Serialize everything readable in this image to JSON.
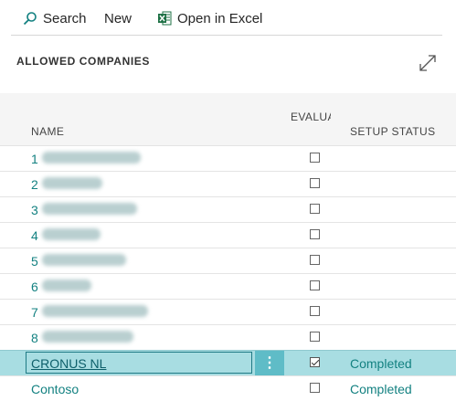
{
  "toolbar": {
    "search_label": "Search",
    "new_label": "New",
    "excel_label": "Open in Excel"
  },
  "page": {
    "title": "ALLOWED COMPANIES"
  },
  "columns": {
    "name": "NAME",
    "evaluation": "EVALUATION COMPANY",
    "setup_status": "SETUP STATUS"
  },
  "rows": [
    {
      "num": "1",
      "blur": true,
      "evaluation": false,
      "status": ""
    },
    {
      "num": "2",
      "blur": true,
      "evaluation": false,
      "status": ""
    },
    {
      "num": "3",
      "blur": true,
      "evaluation": false,
      "status": ""
    },
    {
      "num": "4",
      "blur": true,
      "evaluation": false,
      "status": ""
    },
    {
      "num": "5",
      "blur": true,
      "evaluation": false,
      "status": ""
    },
    {
      "num": "6",
      "blur": true,
      "evaluation": false,
      "status": ""
    },
    {
      "num": "7",
      "blur": true,
      "evaluation": false,
      "status": ""
    },
    {
      "num": "8",
      "blur": true,
      "evaluation": false,
      "status": ""
    },
    {
      "name": "CRONUS NL",
      "evaluation": true,
      "status": "Completed",
      "selected": true
    },
    {
      "name": "Contoso",
      "evaluation": false,
      "status": "Completed"
    }
  ],
  "more_options_glyph": "⋮",
  "colors": {
    "accent": "#138181",
    "selected_row": "#a8dde2",
    "excel_green": "#1e7145"
  }
}
